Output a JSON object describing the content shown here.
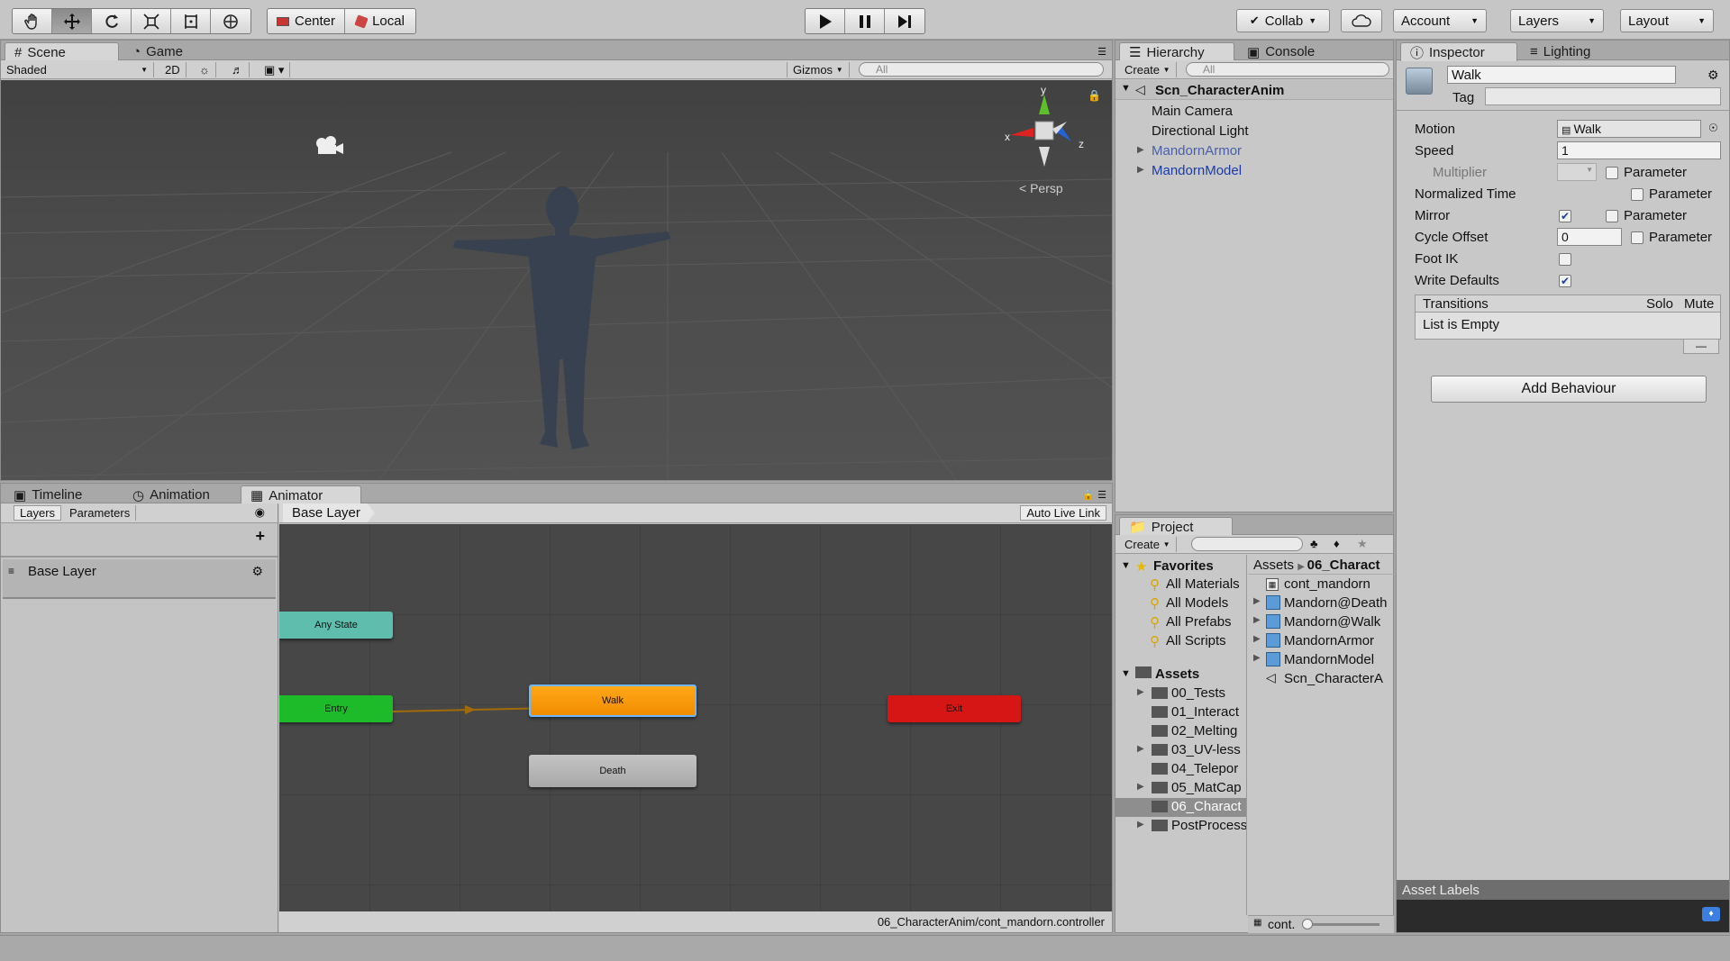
{
  "toolbar": {
    "pivot": "Center",
    "rotation": "Local",
    "collab": "Collab",
    "account": "Account",
    "layers": "Layers",
    "layout": "Layout"
  },
  "scene": {
    "tab_scene": "Scene",
    "tab_game": "Game",
    "shading": "Shaded",
    "mode2d": "2D",
    "gizmos": "Gizmos",
    "search_placeholder": "All",
    "persp": "Persp",
    "axis_x": "x",
    "axis_y": "y",
    "axis_z": "z"
  },
  "hierarchy": {
    "tab": "Hierarchy",
    "tab_console": "Console",
    "create": "Create",
    "search_placeholder": "All",
    "scene_name": "Scn_CharacterAnim",
    "items": [
      "Main Camera",
      "Directional Light",
      "MandornArmor",
      "MandornModel"
    ]
  },
  "inspector": {
    "tab": "Inspector",
    "tab_lighting": "Lighting",
    "name": "Walk",
    "tag_label": "Tag",
    "motion_label": "Motion",
    "motion_value": "Walk",
    "speed_label": "Speed",
    "speed_value": "1",
    "multiplier_label": "Multiplier",
    "normalized_time_label": "Normalized Time",
    "mirror_label": "Mirror",
    "cycle_offset_label": "Cycle Offset",
    "cycle_offset_value": "0",
    "foot_ik_label": "Foot IK",
    "write_defaults_label": "Write Defaults",
    "parameter": "Parameter",
    "transitions": "Transitions",
    "solo": "Solo",
    "mute": "Mute",
    "list_empty": "List is Empty",
    "add_behaviour": "Add Behaviour",
    "asset_labels": "Asset Labels"
  },
  "animator": {
    "tab_timeline": "Timeline",
    "tab_animation": "Animation",
    "tab_animator": "Animator",
    "layers_tab": "Layers",
    "params_tab": "Parameters",
    "base_layer": "Base Layer",
    "breadcrumb": "Base Layer",
    "auto_live_link": "Auto Live Link",
    "path": "06_CharacterAnim/cont_mandorn.controller",
    "nodes": {
      "any_state": "Any State",
      "entry": "Entry",
      "walk": "Walk",
      "death": "Death",
      "exit": "Exit"
    }
  },
  "project": {
    "tab": "Project",
    "create": "Create",
    "favorites": "Favorites",
    "fav_items": [
      "All Materials",
      "All Models",
      "All Prefabs",
      "All Scripts"
    ],
    "assets": "Assets",
    "asset_folders": [
      "00_Tests",
      "01_Interact",
      "02_Melting",
      "03_UV-less",
      "04_Telepor",
      "05_MatCap",
      "06_Charact",
      "PostProcess"
    ],
    "crumb_assets": "Assets",
    "crumb_folder": "06_Charact",
    "files": [
      "cont_mandorn",
      "Mandorn@Death",
      "Mandorn@Walk",
      "MandornArmor",
      "MandornModel",
      "Scn_CharacterA"
    ],
    "bottom": "cont."
  }
}
